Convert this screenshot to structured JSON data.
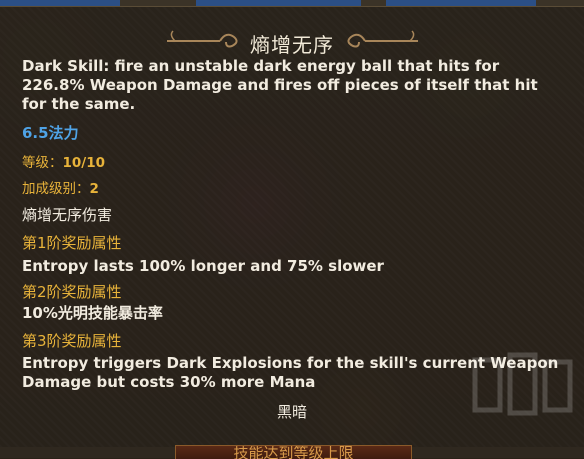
{
  "skill": {
    "title": "熵增无序",
    "description": "Dark Skill: fire an unstable dark energy ball that hits for 226.8% Weapon Damage and fires off pieces of itself that hit for the same.",
    "mana_cost": "6.5法力",
    "level_label": "等级：",
    "level_value": "10/10",
    "bonus_label": "加成级别：",
    "bonus_value": "2",
    "damage_type": "熵增无序伤害",
    "tier1_header": "第1阶奖励属性",
    "tier1_text": "Entropy lasts 100% longer and 75% slower",
    "tier2_header": "第2阶奖励属性",
    "tier2_text": "10%光明技能暴击率",
    "tier3_header": "第3阶奖励属性",
    "tier3_text": "Entropy triggers Dark Explosions for the skill's current Weapon Damage but costs 30% more Mana",
    "element": "黑暗"
  },
  "bottom_button": {
    "label": "技能达到等级上限"
  },
  "colors": {
    "panel_bg": "#28221a",
    "text_white": "#f2ece0",
    "mana_blue": "#4fa3e6",
    "tier_gold": "#e8b33a",
    "button_bg": "#5a2a16"
  },
  "icons": {
    "title_ornament": "scroll-ornament-icon",
    "watermark": "watermark-logo-icon"
  }
}
